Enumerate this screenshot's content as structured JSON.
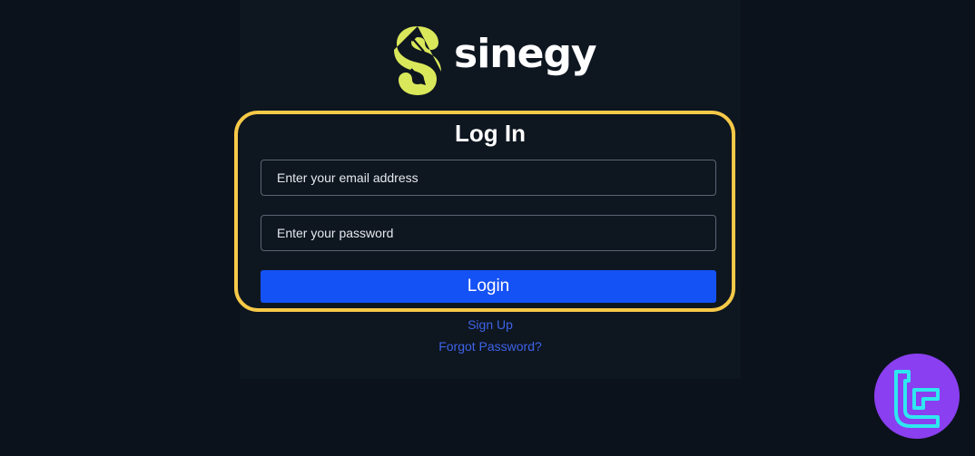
{
  "brand": {
    "name": "sinegy",
    "logo_icon": "sinegy-s-arrows-icon",
    "logo_color": "#d9e85a"
  },
  "login": {
    "title": "Log In",
    "email_placeholder": "Enter your email address",
    "password_placeholder": "Enter your password",
    "submit_label": "Login",
    "signup_label": "Sign Up",
    "forgot_label": "Forgot Password?"
  },
  "colors": {
    "background": "#0b121c",
    "panel": "#0e1620",
    "highlight_border": "#f7c948",
    "primary_button": "#1552f5",
    "link": "#3e63e6",
    "badge": "#8a3ff0"
  },
  "watermark": {
    "icon": "tradingfinder-logo-icon"
  }
}
